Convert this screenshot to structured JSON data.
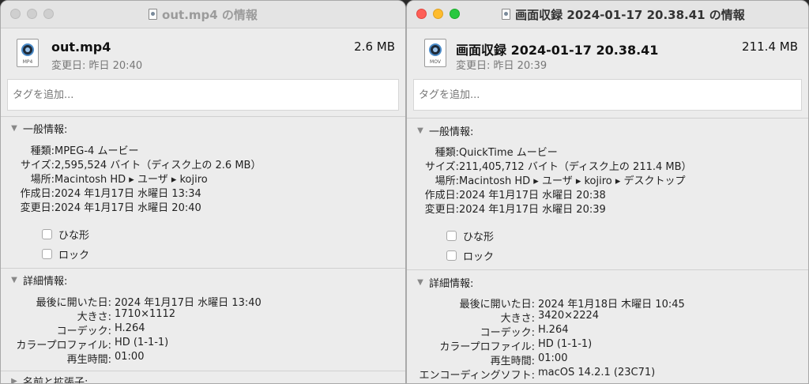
{
  "window_a": {
    "title": "out.mp4 の情報",
    "file_name": "out.mp4",
    "file_size": "2.6 MB",
    "modified": "変更日: 昨日 20:40",
    "icon_ext": "MP4",
    "tags_placeholder": "タグを追加...",
    "general": {
      "title": "一般情報:",
      "rows": [
        {
          "label": "種類:",
          "value": "MPEG-4 ムービー"
        },
        {
          "label": "サイズ:",
          "value": "2,595,524 バイト（ディスク上の 2.6 MB）"
        },
        {
          "label": "場所:",
          "value": "Macintosh HD ▸ ユーザ ▸ kojiro"
        },
        {
          "label": "作成日:",
          "value": "2024 年1月17日 水曜日 13:34"
        },
        {
          "label": "変更日:",
          "value": "2024 年1月17日 水曜日 20:40"
        }
      ],
      "stationery": "ひな形",
      "locked": "ロック"
    },
    "details": {
      "title": "詳細情報:",
      "rows": [
        {
          "label": "最後に開いた日:",
          "value": "2024 年1月17日 水曜日 13:40"
        },
        {
          "label": "大きさ:",
          "value": "1710×1112"
        },
        {
          "label": "コーデック:",
          "value": "H.264"
        },
        {
          "label": "カラープロファイル:",
          "value": "HD (1-1-1)"
        },
        {
          "label": "再生時間:",
          "value": "01:00"
        }
      ]
    },
    "name_ext": {
      "title": "名前と拡張子:"
    }
  },
  "window_b": {
    "title": "画面収録 2024-01-17 20.38.41 の情報",
    "file_name": "画面収録 2024-01-17 20.38.41",
    "file_size": "211.4 MB",
    "modified": "変更日: 昨日 20:39",
    "icon_ext": "MOV",
    "tags_placeholder": "タグを追加...",
    "general": {
      "title": "一般情報:",
      "rows": [
        {
          "label": "種類:",
          "value": "QuickTime ムービー"
        },
        {
          "label": "サイズ:",
          "value": "211,405,712 バイト（ディスク上の 211.4 MB）"
        },
        {
          "label": "場所:",
          "value": "Macintosh HD ▸ ユーザ ▸ kojiro ▸ デスクトップ"
        },
        {
          "label": "作成日:",
          "value": "2024 年1月17日 水曜日 20:38"
        },
        {
          "label": "変更日:",
          "value": "2024 年1月17日 水曜日 20:39"
        }
      ],
      "stationery": "ひな形",
      "locked": "ロック"
    },
    "details": {
      "title": "詳細情報:",
      "rows": [
        {
          "label": "最後に開いた日:",
          "value": "2024 年1月18日 木曜日 10:45"
        },
        {
          "label": "大きさ:",
          "value": "3420×2224"
        },
        {
          "label": "コーデック:",
          "value": "H.264"
        },
        {
          "label": "カラープロファイル:",
          "value": "HD (1-1-1)"
        },
        {
          "label": "再生時間:",
          "value": "01:00"
        },
        {
          "label": "エンコーディングソフト:",
          "value": "macOS 14.2.1 (23C71)"
        }
      ]
    }
  }
}
